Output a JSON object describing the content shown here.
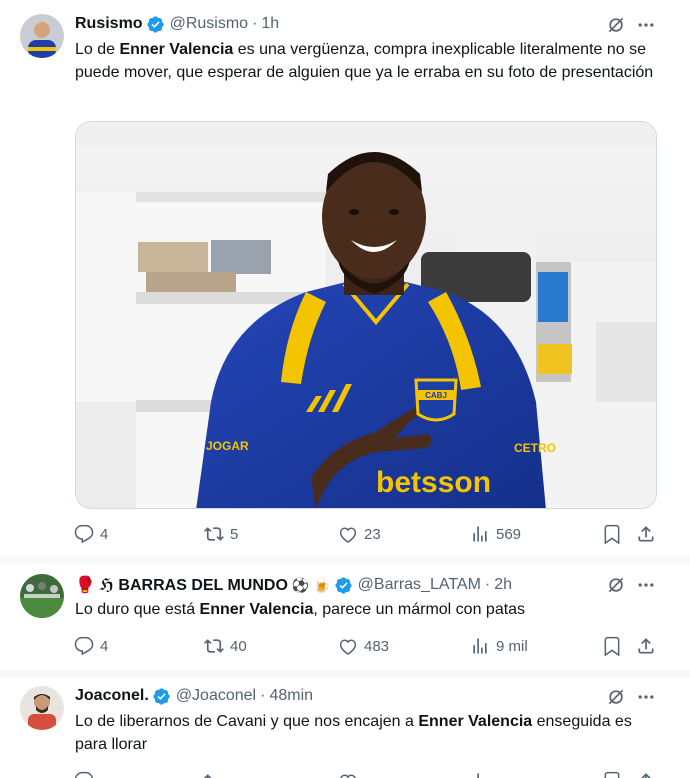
{
  "tweets": [
    {
      "name": "Rusismo",
      "handle": "@Rusismo",
      "sep": "·",
      "time": "1h",
      "text_parts": [
        "Lo de ",
        "Enner Valencia",
        " es una vergüenza, compra inexplicable literalmente no se puede mover, que esperar de alguien que ya le erraba en su foto de presentación"
      ],
      "replies": "4",
      "retweets": "5",
      "likes": "23",
      "views": "569"
    },
    {
      "name": "🥊 ℌ BARRAS DEL MUNDO",
      "name_emojis": "⚽ 🍺",
      "handle": "@Barras_LATAM",
      "sep": "·",
      "time": "2h",
      "text_parts": [
        "Lo duro que está ",
        "Enner Valencia",
        ", parece un mármol con patas"
      ],
      "replies": "4",
      "retweets": "40",
      "likes": "483",
      "views": "9 mil"
    },
    {
      "name": "Joaconel.",
      "handle": "@Joaconel",
      "sep": "·",
      "time": "48min",
      "text_parts": [
        "Lo de liberarnos de Cavani y que nos encajen a ",
        "Enner Valencia",
        " enseguida es para llorar"
      ]
    }
  ],
  "media_jersey_text": {
    "sponsor": "betsson",
    "badge": "CABJ",
    "left_sleeve": "JOGAR",
    "right_sleeve": "CETRO"
  },
  "colors": {
    "text": "#0f1419",
    "secondary": "#536471",
    "verified": "#1d9bf0",
    "divider": "#eff3f4",
    "jersey_blue": "#1c3fa8",
    "jersey_yellow": "#f5c400"
  },
  "icons": [
    "verified-badge-icon",
    "grok-icon",
    "more-icon",
    "reply-icon",
    "retweet-icon",
    "like-icon",
    "views-icon",
    "bookmark-icon",
    "share-icon"
  ]
}
